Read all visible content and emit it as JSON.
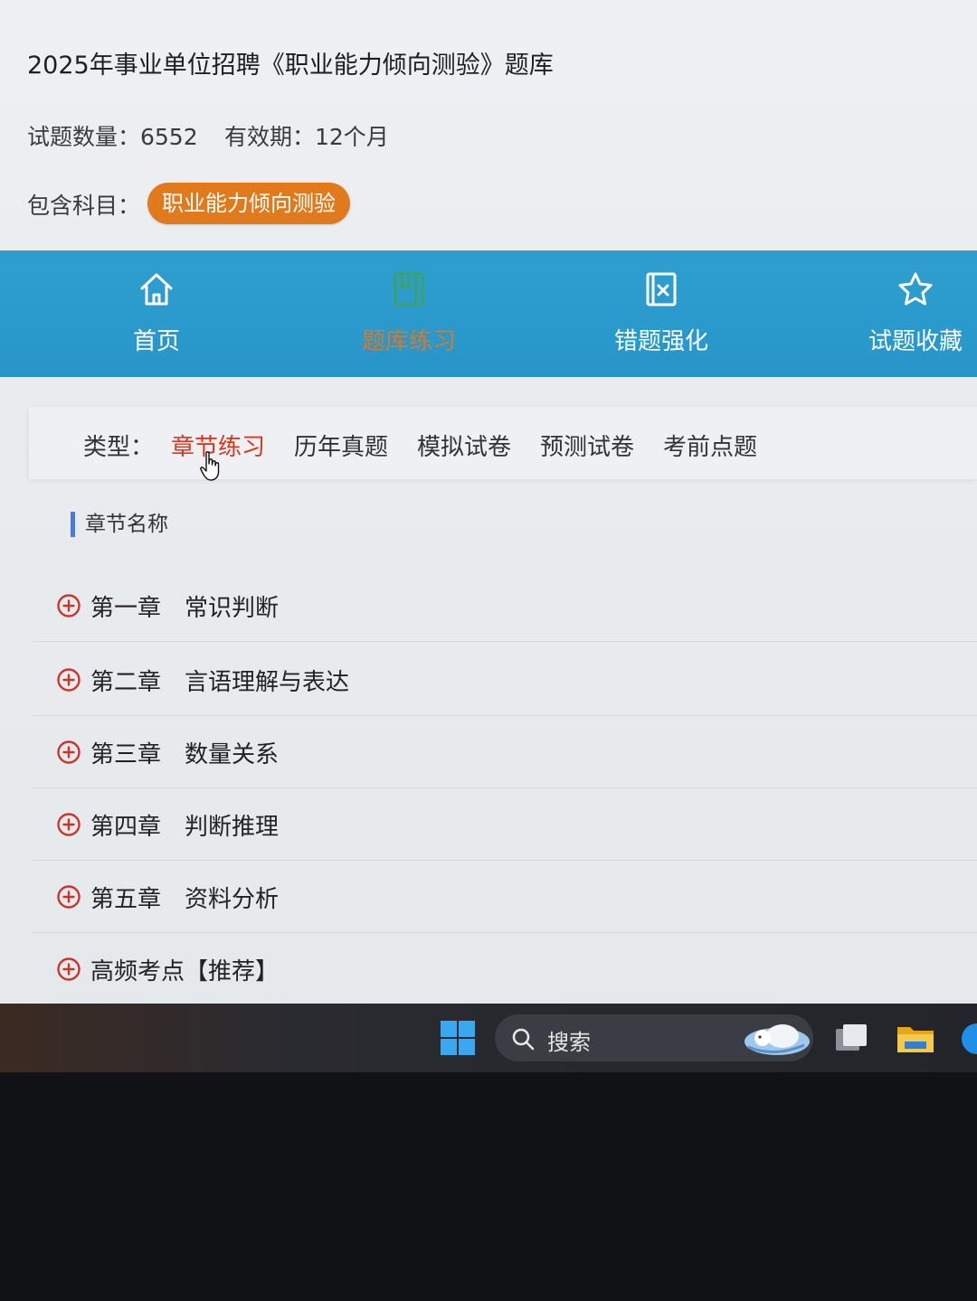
{
  "header": {
    "title": "2025年事业单位招聘《职业能力倾向测验》题库",
    "question_count": "试题数量：6552",
    "validity": "有效期：12个月",
    "subjects_label": "包含科目：",
    "subject_chip": "职业能力倾向测验"
  },
  "nav": {
    "items": [
      {
        "label": "首页",
        "icon": "home-icon"
      },
      {
        "label": "题库练习",
        "icon": "book-icon"
      },
      {
        "label": "错题强化",
        "icon": "wrong-book-icon"
      },
      {
        "label": "试题收藏",
        "icon": "star-icon"
      }
    ],
    "active_index": 1
  },
  "types": {
    "label": "类型：",
    "items": [
      "章节练习",
      "历年真题",
      "模拟试卷",
      "预测试卷",
      "考前点题"
    ],
    "active_index": 0
  },
  "chapters": {
    "heading": "章节名称",
    "items": [
      {
        "num": "第一章",
        "name": "常识判断"
      },
      {
        "num": "第二章",
        "name": "言语理解与表达"
      },
      {
        "num": "第三章",
        "name": "数量关系"
      },
      {
        "num": "第四章",
        "name": "判断推理"
      },
      {
        "num": "第五章",
        "name": "资料分析"
      },
      {
        "num": "高频考点【推荐】",
        "name": ""
      }
    ]
  },
  "taskbar": {
    "search_placeholder": "搜索"
  },
  "colors": {
    "nav_bg": "#2795c8",
    "accent_orange": "#e07a1c",
    "active_red": "#d9381e",
    "section_bar": "#4a7bd8",
    "plus_icon": "#c9372c"
  }
}
